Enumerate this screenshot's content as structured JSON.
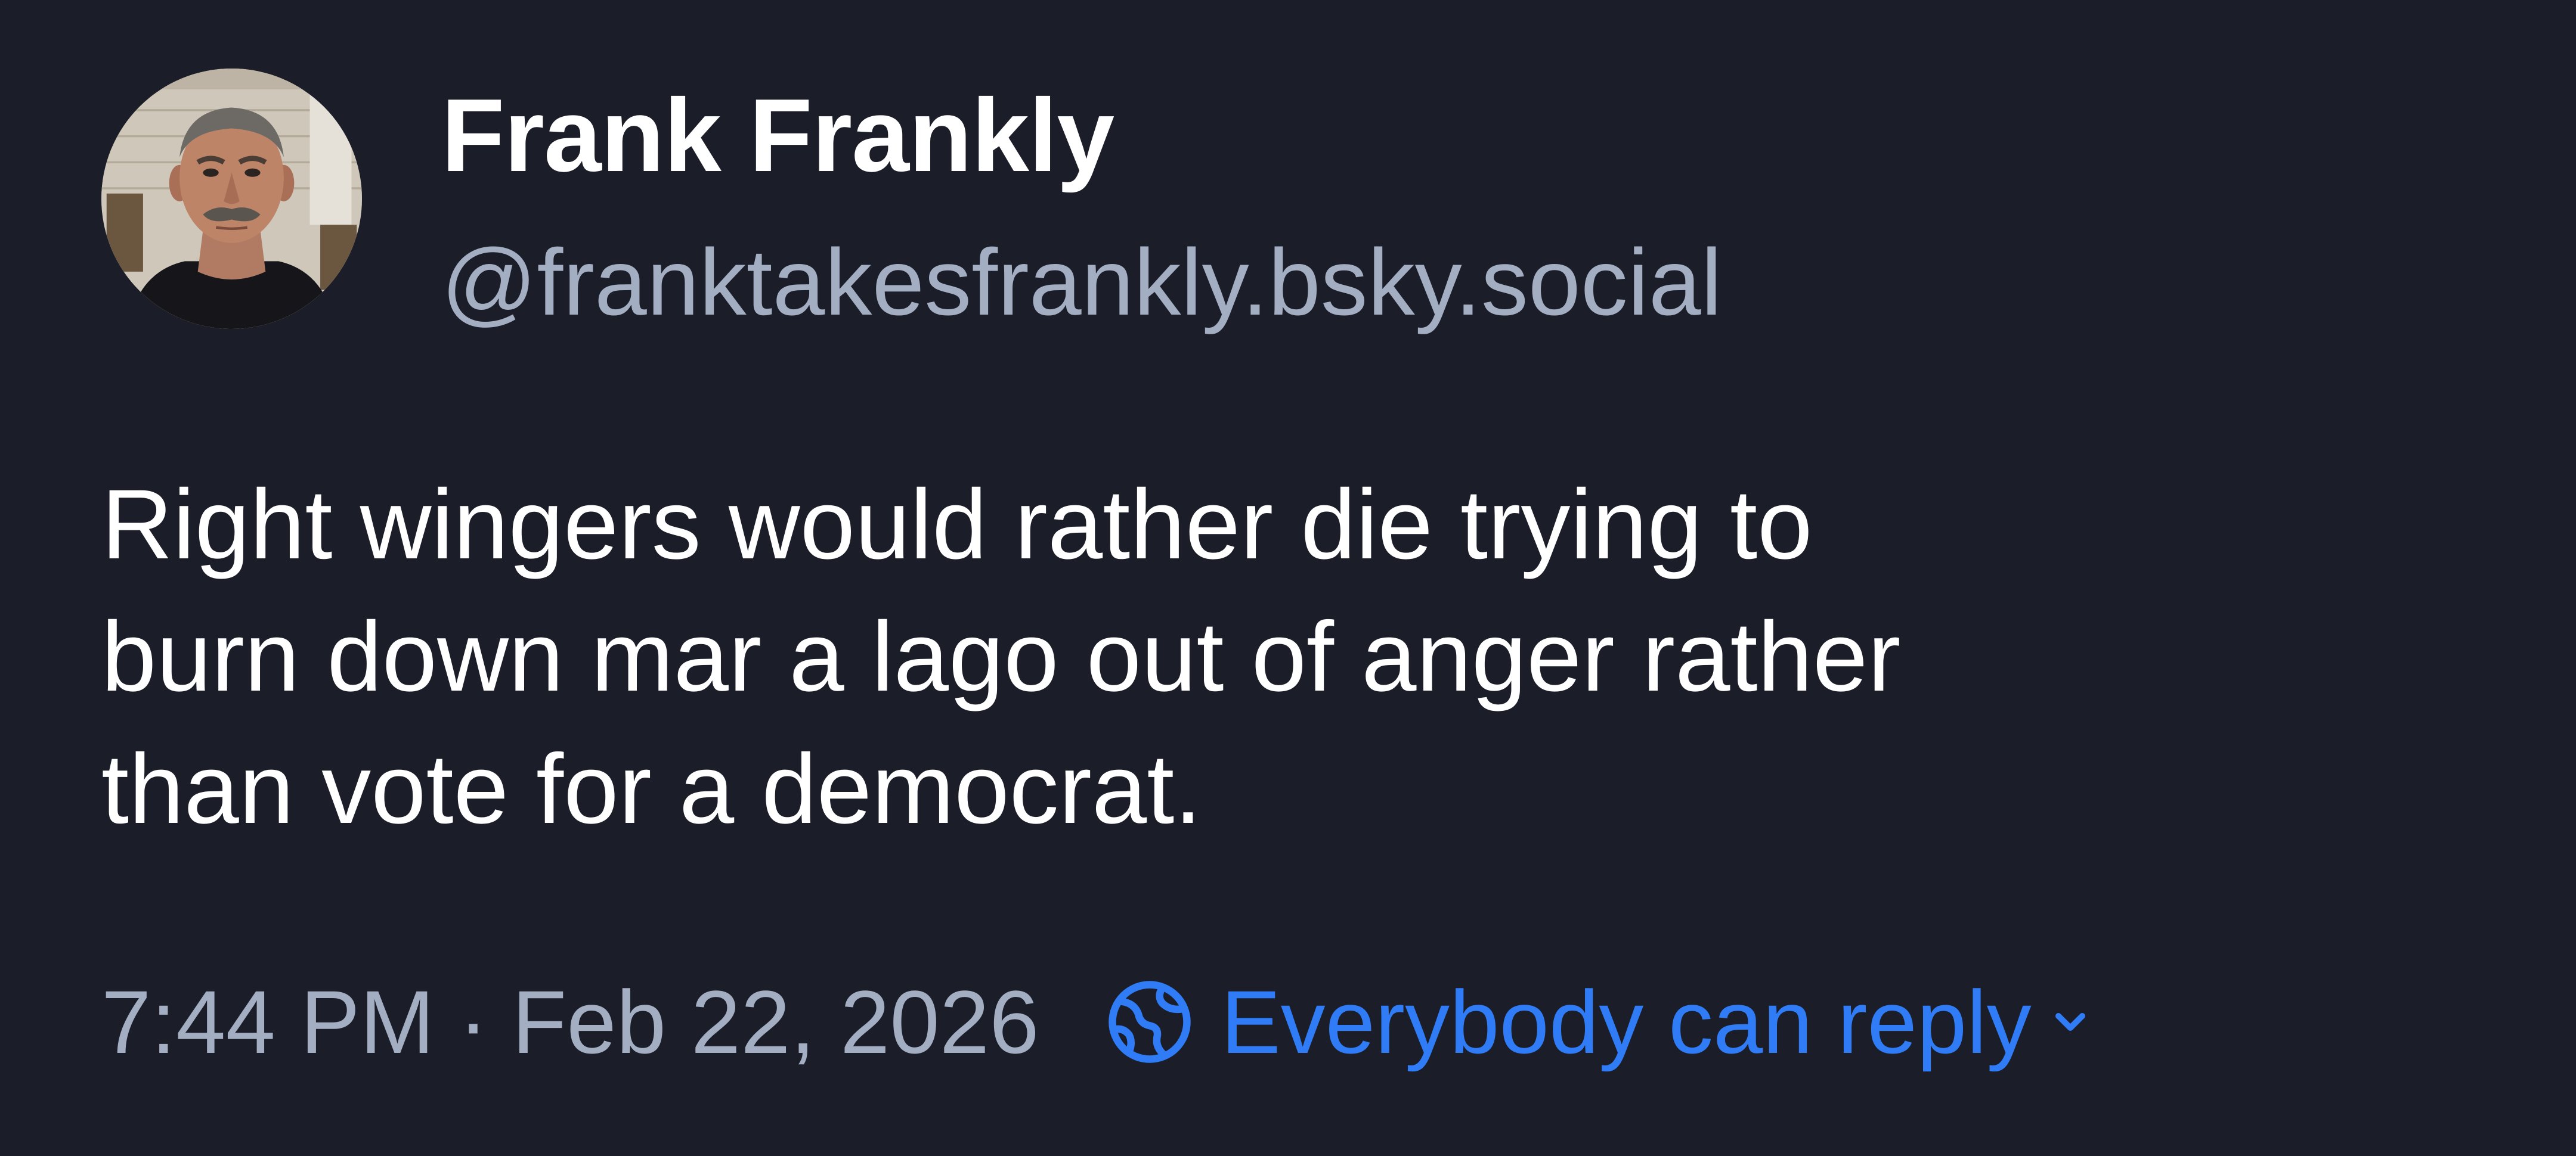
{
  "author": {
    "display_name": "Frank Frankly",
    "handle": "@franktakesfrankly.bsky.social",
    "avatar_icon": "profile-photo"
  },
  "post": {
    "text_lines": [
      "Right wingers would rather die trying to",
      "burn down mar a lago out of anger rather",
      "than vote for a democrat."
    ]
  },
  "footer": {
    "time": "7:44 PM",
    "separator": "·",
    "date": "Feb 22, 2026",
    "reply_setting_label": "Everybody can reply",
    "reply_icon": "globe-icon",
    "dropdown_icon": "chevron-down-icon"
  },
  "colors": {
    "background": "#1b1e28",
    "primary_text": "#ffffff",
    "secondary_text": "#a3aec2",
    "accent": "#2f7cf6"
  }
}
